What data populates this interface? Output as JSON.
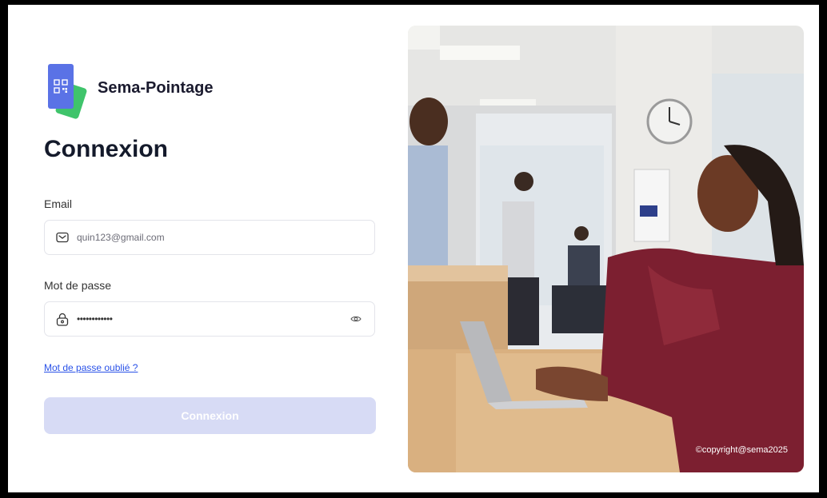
{
  "brand": {
    "name": "Sema-Pointage",
    "logo_icon": "qr-card-icon"
  },
  "login": {
    "title": "Connexion",
    "email_label": "Email",
    "email_value": "quin123@gmail.com",
    "password_label": "Mot de passe",
    "password_value": "••••••••••••",
    "forgot_link": "Mot de passe oublié ?",
    "submit_label": "Connexion"
  },
  "photo": {
    "copyright": "©copyright@sema2025"
  },
  "colors": {
    "brand_blue": "#5a72e6",
    "brand_green": "#3fc46b",
    "link": "#2a52e8",
    "button_disabled": "#d7dbf5"
  }
}
